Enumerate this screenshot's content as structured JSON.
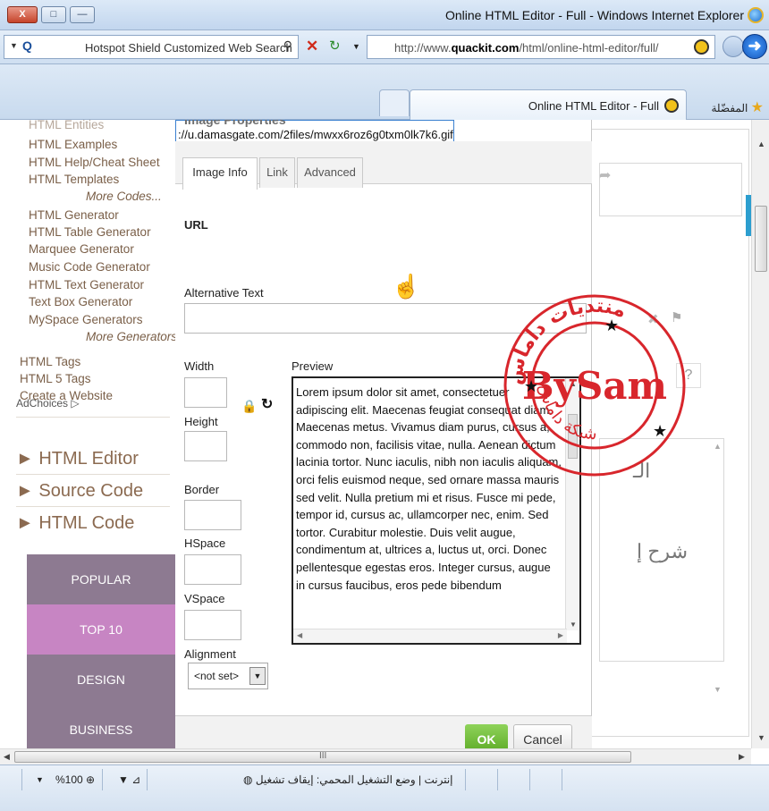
{
  "window": {
    "title": "Online HTML Editor - Full - Windows Internet Explorer",
    "close_label": "X",
    "max_label": "□",
    "min_label": "—"
  },
  "addressbar": {
    "search_placeholder": "Hotspot Shield Customized Web Search",
    "url_prefix": "http://www.",
    "url_domain": "quackit.com",
    "url_path": "/html/online-html-editor/full/"
  },
  "tabs": {
    "active_label": "Online HTML Editor - Full",
    "favorites_label": "المفضّلة"
  },
  "nav": {
    "links": [
      {
        "label": "HTML Examples"
      },
      {
        "label": "HTML Help/Cheat Sheet"
      },
      {
        "label": "HTML Templates"
      },
      {
        "label": "More Codes..."
      },
      {
        "label": "HTML Generator"
      },
      {
        "label": "HTML Table Generator"
      },
      {
        "label": "Marquee Generator"
      },
      {
        "label": "Music Code Generator"
      },
      {
        "label": "HTML Text Generator"
      },
      {
        "label": "Text Box Generator"
      },
      {
        "label": "MySpace Generators"
      },
      {
        "label": "More Generators"
      },
      {
        "label": "HTML Tags"
      },
      {
        "label": "HTML 5 Tags"
      },
      {
        "label": "Create a Website"
      }
    ],
    "adchoices": "AdChoices ▷",
    "big_links": [
      {
        "label": "► HTML Editor"
      },
      {
        "label": "► Source Code"
      },
      {
        "label": "► HTML Code"
      }
    ],
    "categories": [
      {
        "label": "POPULAR",
        "color": "#8d7a91"
      },
      {
        "label": "TOP 10",
        "color": "#c785c3"
      },
      {
        "label": "DESIGN",
        "color": "#8d7a91"
      },
      {
        "label": "BUSINESS",
        "color": "#8d7a91"
      }
    ]
  },
  "dialog": {
    "title": "Image Properties",
    "tabs": {
      "image_info": "Image Info",
      "link": "Link",
      "advanced": "Advanced"
    },
    "url_label": "URL",
    "url_value": "://u.damasgate.com/2files/mwxx6roz6g0txm0lk7k6.gif",
    "alt_label": "Alternative Text",
    "width_label": "Width",
    "height_label": "Height",
    "border_label": "Border",
    "hspace_label": "HSpace",
    "vspace_label": "VSpace",
    "alignment_label": "Alignment",
    "alignment_value": "<not set>",
    "preview_label": "Preview",
    "preview_text": "Lorem ipsum dolor sit amet, consectetuer adipiscing elit. Maecenas feugiat consequat diam. Maecenas metus. Vivamus diam purus, cursus a, commodo non, facilisis vitae, nulla. Aenean dictum lacinia tortor. Nunc iaculis, nibh non iaculis aliquam, orci felis euismod neque, sed ornare massa mauris sed velit. Nulla pretium mi et risus. Fusce mi pede, tempor id, cursus ac, ullamcorper nec, enim. Sed tortor. Curabitur molestie. Duis velit augue, condimentum at, ultrices a, luctus ut, orci. Donec pellentesque egestas eros. Integer cursus, augue in cursus faucibus, eros pede bibendum",
    "ok_label": "OK",
    "cancel_label": "Cancel"
  },
  "editor_bg": {
    "arabic_title": "الـ",
    "arabic_text": "شرح إ",
    "help_label": "?"
  },
  "watermark": {
    "main": "BySam",
    "ring_text": "منتديات داماس",
    "ring_text2": "شبكة داماس",
    "color": "#d8262c"
  },
  "statusbar": {
    "zoom": "%100",
    "text": "إنترنت | وضع التشغيل المحمي: إيقاف تشغيل"
  },
  "scroll": {
    "hscroll_label": "III"
  }
}
